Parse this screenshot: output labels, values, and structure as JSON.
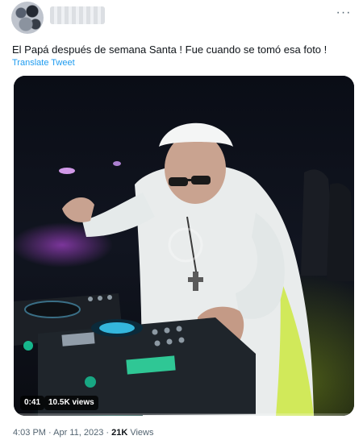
{
  "header": {
    "more_icon": "more-horizontal-icon",
    "more_label": "···"
  },
  "tweet": {
    "text": "El Papá después de semana Santa ! Fue cuando se tomó esa foto !",
    "translate_label": "Translate Tweet"
  },
  "video": {
    "duration": "0:41",
    "views_badge": "10.5K views"
  },
  "meta": {
    "time": "4:03 PM",
    "separator": " · ",
    "date": "Apr 11, 2023",
    "views_count": "21K",
    "views_label": " Views"
  },
  "colors": {
    "link": "#1d9bf0",
    "secondary_text": "#536471",
    "primary_text": "#0f1419"
  }
}
